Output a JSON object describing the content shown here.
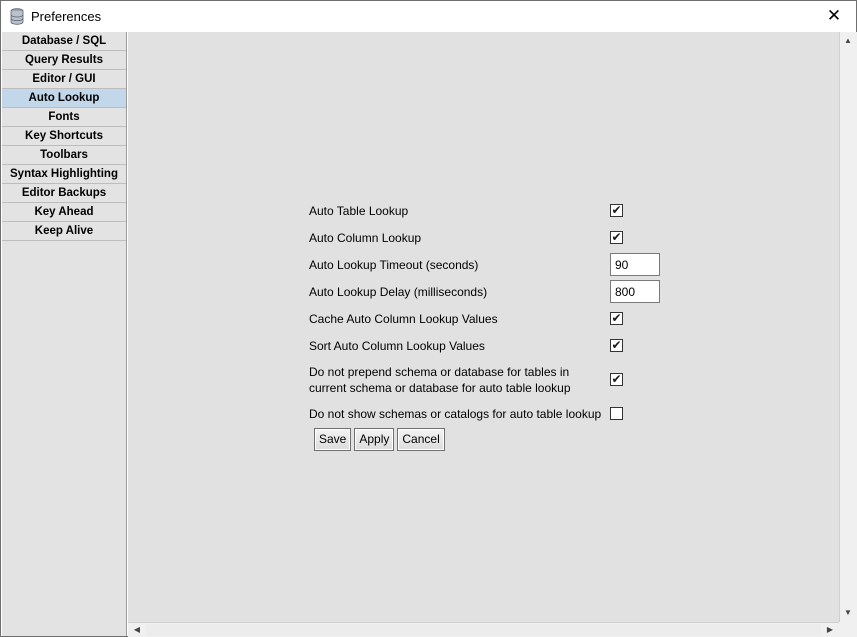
{
  "window": {
    "title": "Preferences",
    "close_glyph": "✕",
    "icon": "database-icon"
  },
  "sidebar": {
    "selected_index": 3,
    "items": [
      {
        "label": "Database / SQL"
      },
      {
        "label": "Query Results"
      },
      {
        "label": "Editor / GUI"
      },
      {
        "label": "Auto Lookup"
      },
      {
        "label": "Fonts"
      },
      {
        "label": "Key Shortcuts"
      },
      {
        "label": "Toolbars"
      },
      {
        "label": "Syntax Highlighting"
      },
      {
        "label": "Editor Backups"
      },
      {
        "label": "Key Ahead"
      },
      {
        "label": "Keep Alive"
      }
    ]
  },
  "settings": {
    "auto_table_lookup": {
      "label": "Auto Table Lookup",
      "checked": true
    },
    "auto_column_lookup": {
      "label": "Auto Column Lookup",
      "checked": true
    },
    "lookup_timeout": {
      "label": "Auto Lookup Timeout (seconds)",
      "value": "90"
    },
    "lookup_delay": {
      "label": "Auto Lookup Delay (milliseconds)",
      "value": "800"
    },
    "cache_column_lookup": {
      "label": "Cache Auto Column Lookup Values",
      "checked": true
    },
    "sort_column_lookup": {
      "label": "Sort Auto Column Lookup Values",
      "checked": true
    },
    "no_prepend_schema": {
      "label": "Do not prepend schema or database for tables in current schema or database for auto table lookup",
      "checked": true
    },
    "no_show_schemas": {
      "label": "Do not show schemas or catalogs for auto table lookup",
      "checked": false
    }
  },
  "actions": {
    "save_label": "Save",
    "apply_label": "Apply",
    "cancel_label": "Cancel"
  },
  "scrollbars": {
    "up_glyph": "▲",
    "down_glyph": "▼",
    "left_glyph": "◀",
    "right_glyph": "▶"
  },
  "colors": {
    "selected_item": "#c3d7eb",
    "panel_background": "#e1e1e1",
    "sidebar_background": "#e3e3e3"
  }
}
